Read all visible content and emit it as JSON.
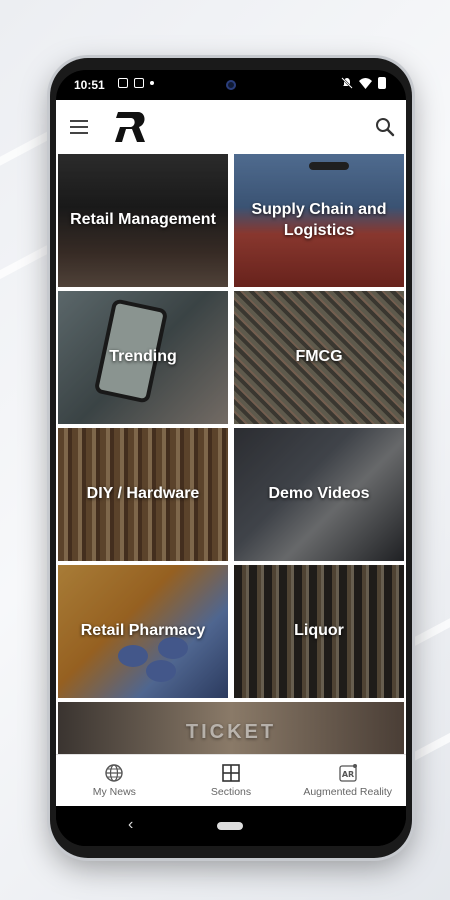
{
  "status_bar": {
    "time": "10:51",
    "icons": [
      "image-icon",
      "message-icon",
      "dot-icon",
      "mute-icon",
      "wifi-icon",
      "battery-icon"
    ]
  },
  "app_bar": {
    "logo": "R",
    "menu_icon": "hamburger-icon",
    "search_icon": "search-icon"
  },
  "sections": [
    {
      "label": "Retail Management"
    },
    {
      "label": "Supply Chain and Logistics"
    },
    {
      "label": "Trending"
    },
    {
      "label": "FMCG"
    },
    {
      "label": "DIY / Hardware"
    },
    {
      "label": "Demo Videos"
    },
    {
      "label": "Retail Pharmacy"
    },
    {
      "label": "Liquor"
    }
  ],
  "partial_tile": {
    "text": "TICKET"
  },
  "bottom_nav": {
    "items": [
      {
        "label": "My News",
        "icon": "globe-icon"
      },
      {
        "label": "Sections",
        "icon": "grid-icon"
      },
      {
        "label": "Augmented Reality",
        "icon": "ar-icon"
      }
    ]
  },
  "colors": {
    "background": "#eceef2",
    "app_bar": "#ffffff",
    "nav_text": "#666666"
  }
}
